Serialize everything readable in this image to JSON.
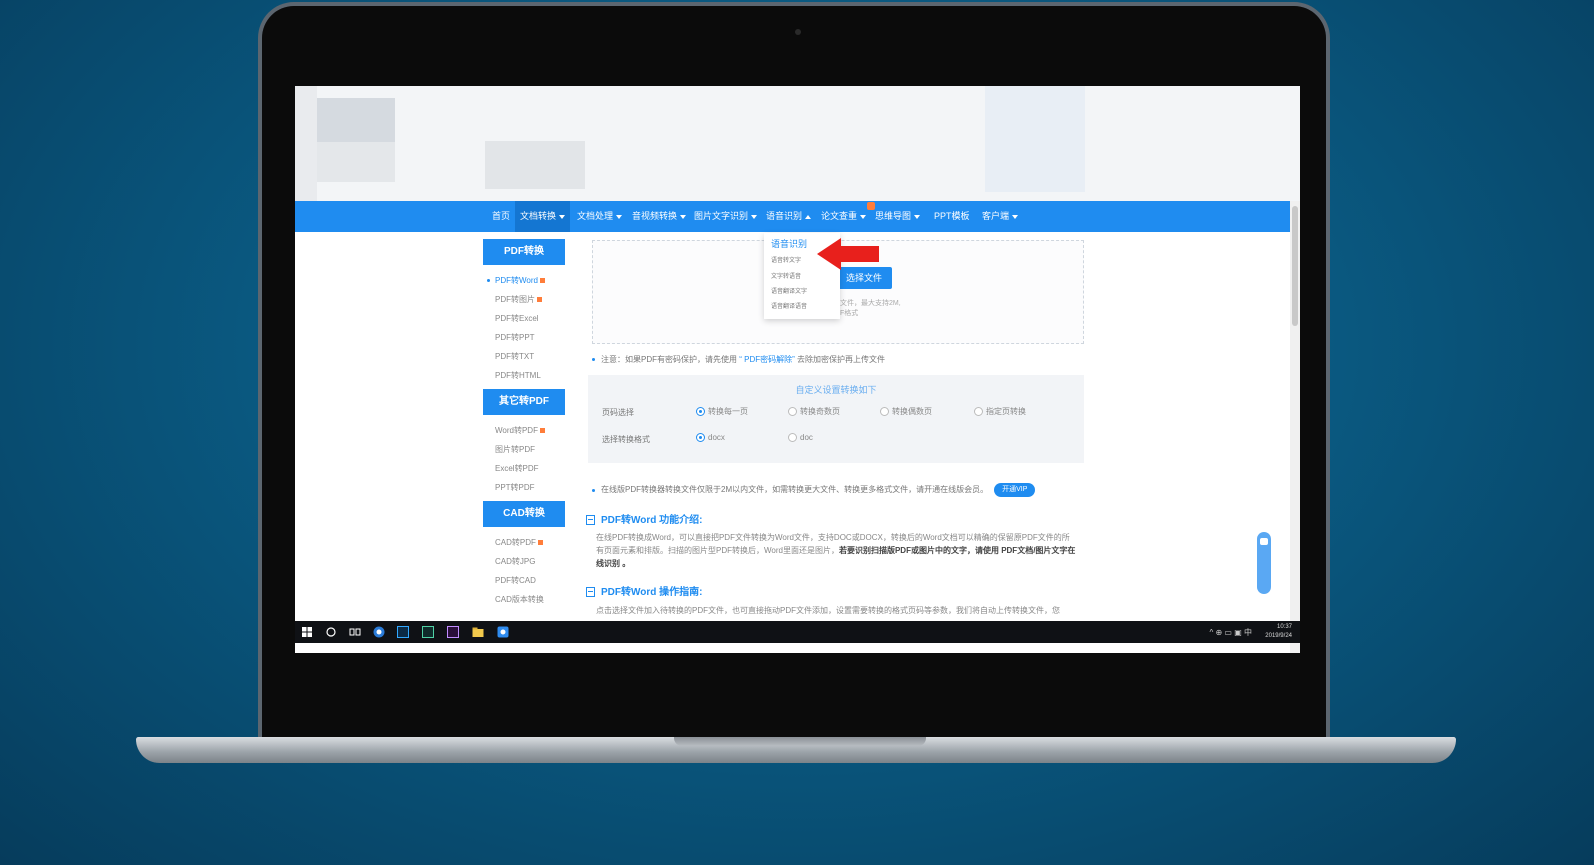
{
  "navbar": {
    "items": [
      {
        "label": "首页"
      },
      {
        "label": "文档转换"
      },
      {
        "label": "文档处理"
      },
      {
        "label": "音视频转换"
      },
      {
        "label": "图片文字识别"
      },
      {
        "label": "语音识别"
      },
      {
        "label": "论文查重"
      },
      {
        "label": "思维导图"
      },
      {
        "label": "PPT模板"
      },
      {
        "label": "客户端"
      }
    ]
  },
  "dropdown": {
    "heading": "语音识别",
    "items": [
      "语音转文字",
      "文字转语音",
      "语音翻译文字",
      "语音翻译语音"
    ]
  },
  "sidebar": {
    "sections": [
      {
        "title": "PDF转换",
        "links": [
          "PDF转Word",
          "PDF转图片",
          "PDF转Excel",
          "PDF转PPT",
          "PDF转TXT",
          "PDF转HTML"
        ]
      },
      {
        "title": "其它转PDF",
        "links": [
          "Word转PDF",
          "图片转PDF",
          "Excel转PDF",
          "PPT转PDF"
        ]
      },
      {
        "title": "CAD转换",
        "links": [
          "CAD转PDF",
          "CAD转JPG",
          "PDF转CAD",
          "CAD版本转换"
        ]
      }
    ]
  },
  "upload": {
    "button": "选择文件",
    "hint_line1": "文件，最大支持2M,",
    "hint_line2": "F格式"
  },
  "notice": {
    "prefix": "注意：如果PDF有密码保护，请先使用",
    "link": "“ PDF密码解除”",
    "suffix": "去除加密保护再上传文件"
  },
  "settings": {
    "title": "自定义设置转换如下",
    "page_label": "页码选择",
    "page_options": [
      "转换每一页",
      "转换奇数页",
      "转换偶数页",
      "指定页转换"
    ],
    "page_selected": "转换每一页",
    "format_label": "选择转换格式",
    "format_options": [
      "docx",
      "doc"
    ],
    "format_selected": "docx"
  },
  "vip": {
    "text": "在线版PDF转换器转换文件仅限于2M以内文件，如需转换更大文件、转换更多格式文件，请开通在线版会员。",
    "button": "开通VIP"
  },
  "intro": {
    "title": "PDF转Word 功能介绍:",
    "body": "在线PDF转换成Word，可以直接把PDF文件转换为Word文件，支持DOC或DOCX，转换后的Word文档可以精确的保留原PDF文件的所有页面元素和排版。扫描的图片型PDF转换后，Word里面还是图片，",
    "bold": "若要识别扫描版PDF或图片中的文字，请使用 PDF文档/图片文字在线识别 。"
  },
  "guide": {
    "title": "PDF转Word 操作指南:",
    "body": "点击选择文件加入待转换的PDF文件，也可直接拖动PDF文件添加，设置需要转换的格式页码等参数，我们将自动上传转换文件，您"
  },
  "float_tab": {
    "label": "在线客服"
  },
  "taskbar": {
    "time": "10:37",
    "date": "2019/9/24",
    "tray": "^ ⊕ ▭ ▣ 中"
  },
  "colors": {
    "accent": "#1f8cf0",
    "nav_active": "#1476d2",
    "badge": "#ff7d3a",
    "arrow": "#e8201c"
  }
}
